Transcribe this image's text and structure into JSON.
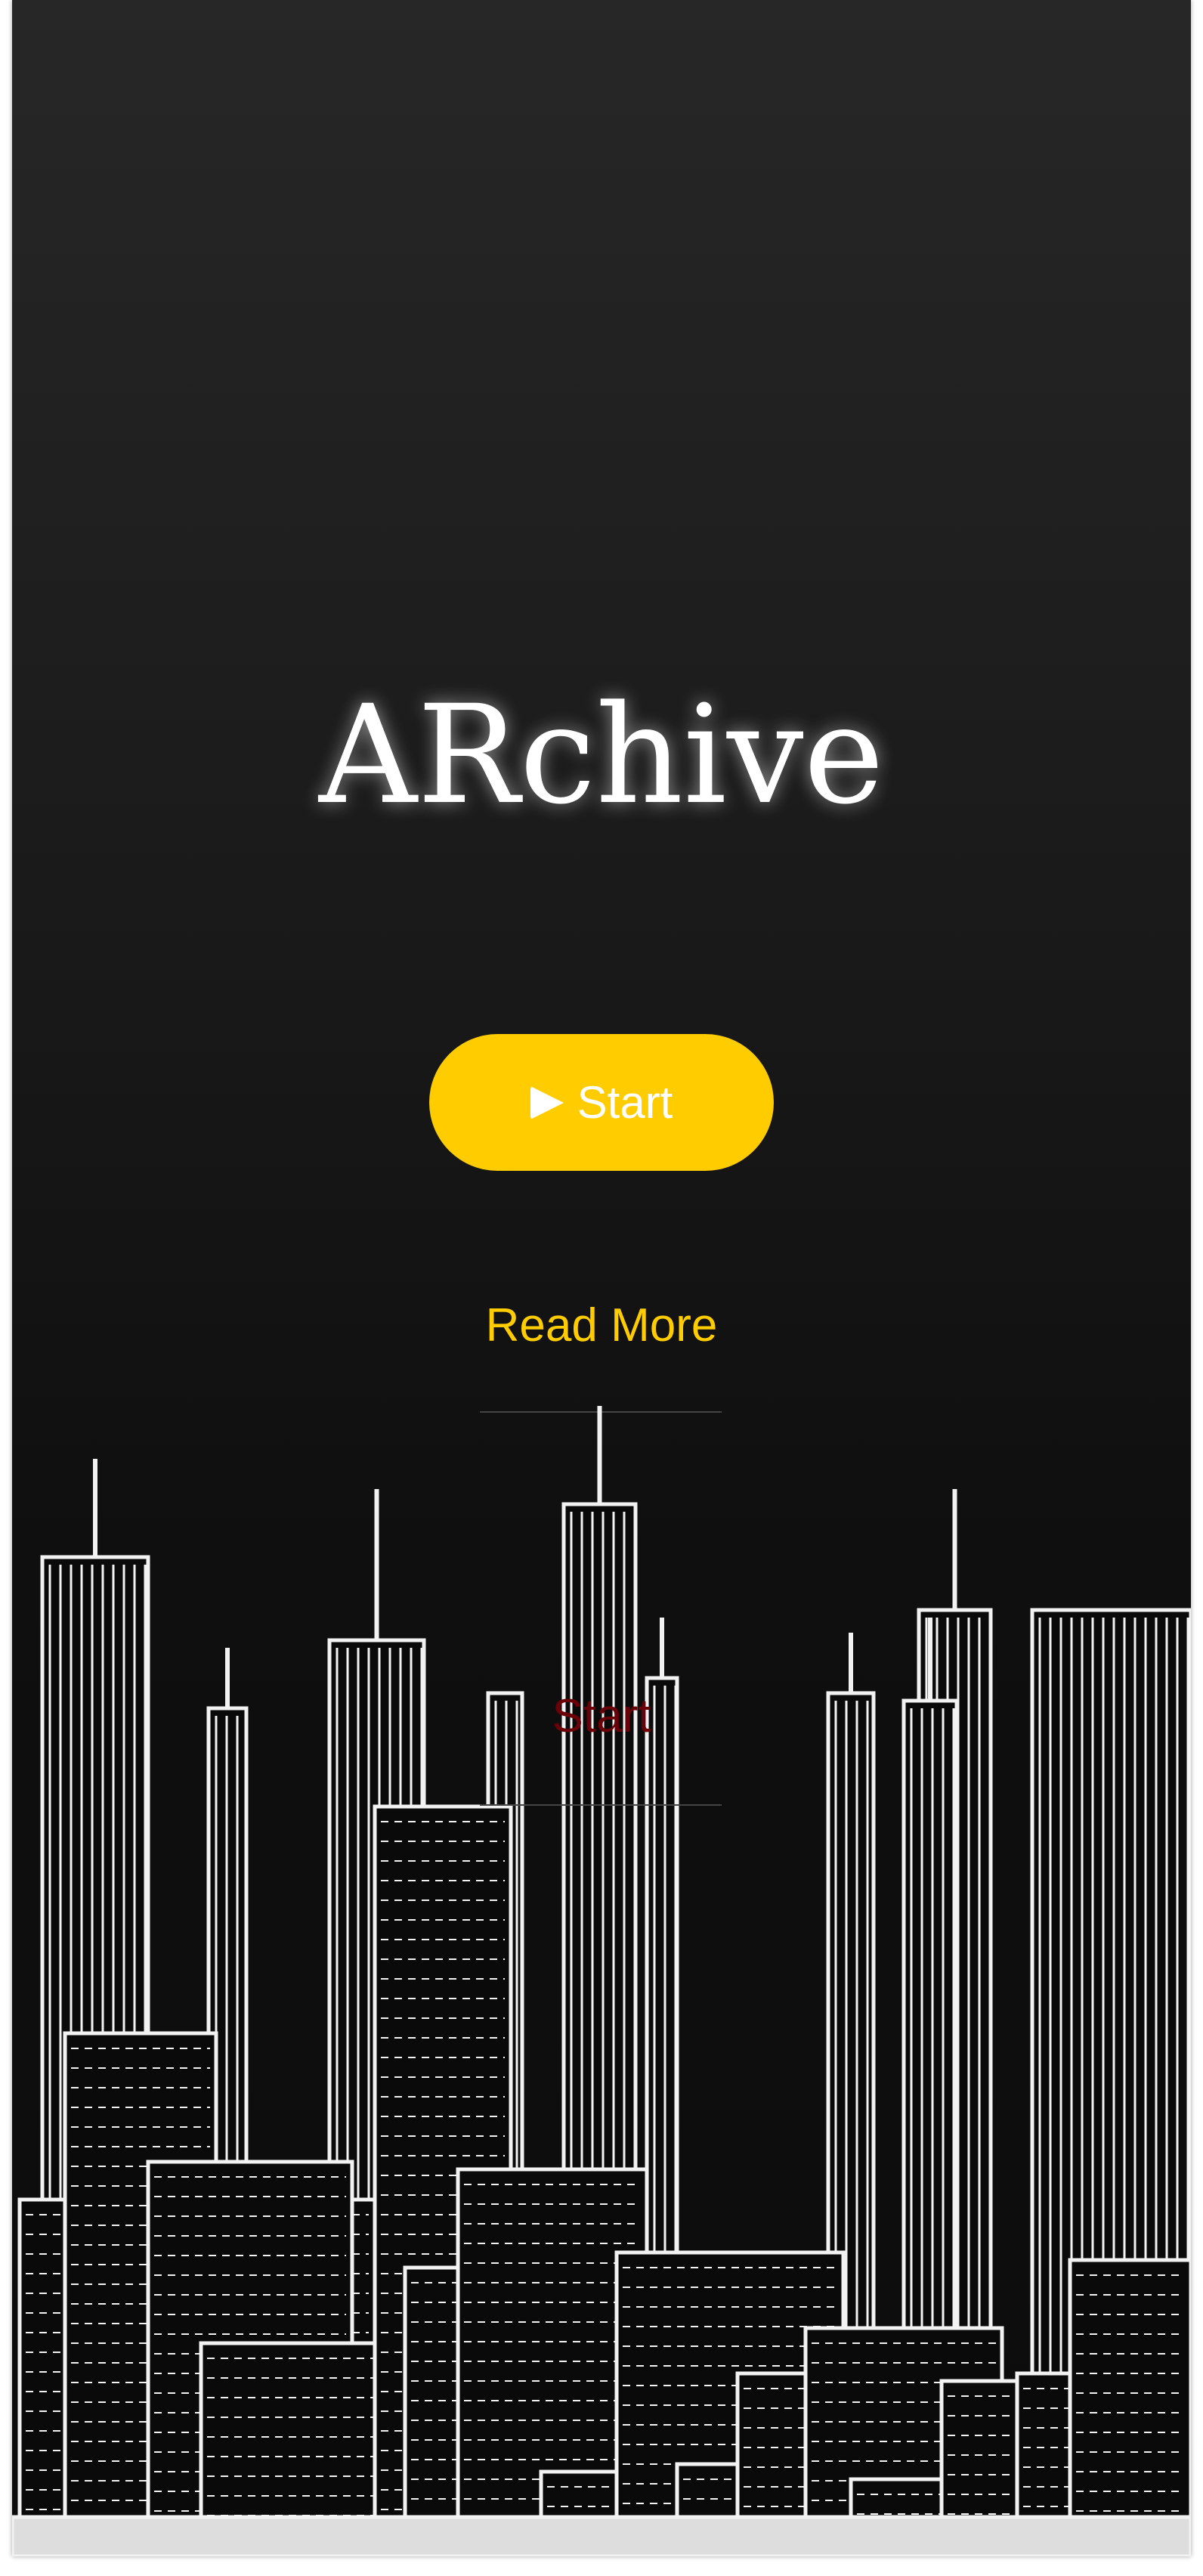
{
  "app": {
    "title": "ARchive"
  },
  "actions": {
    "start_label": "Start",
    "start_icon": "play-icon",
    "read_more_label": "Read More",
    "secondary_start_label": "Start"
  },
  "colors": {
    "accent": "#ffcc00",
    "background": "#111111",
    "ghost_text": "#6a0008"
  }
}
